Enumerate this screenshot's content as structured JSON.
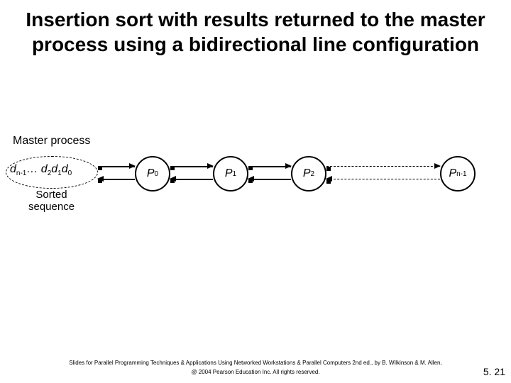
{
  "title": "Insertion sort with results returned to the master process using a bidirectional line configuration",
  "master_label": "Master process",
  "sequence_html": "d<sub>n-1</sub>… d<sub>2</sub>d<sub>1</sub>d<sub>0</sub>",
  "sorted_caption": "Sorted\nsequence",
  "processes": {
    "p0": "P<sub>0</sub>",
    "p1": "P<sub>1</sub>",
    "p2": "P<sub>2</sub>",
    "pn": "P<sub>n-1</sub>"
  },
  "dots": ". . . . . . .",
  "footer_line1": "Slides for Parallel Programming Techniques & Applications Using Networked Workstations & Parallel Computers 2nd ed., by B. Wilkinson & M. Allen,",
  "footer_line2": "@ 2004 Pearson Education Inc. All rights reserved.",
  "page_number": "5. 21"
}
